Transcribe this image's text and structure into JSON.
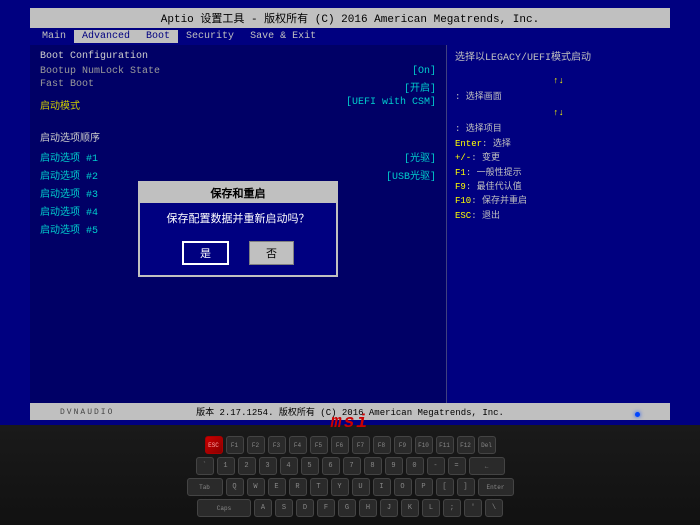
{
  "titleBar": {
    "text": "Aptio 设置工具 - 版权所有 (C) 2016 American Megatrends, Inc."
  },
  "menuBar": {
    "items": [
      {
        "id": "main",
        "label": "Main",
        "active": false
      },
      {
        "id": "advanced",
        "label": "Advanced",
        "active": false
      },
      {
        "id": "boot",
        "label": "Boot",
        "active": true
      },
      {
        "id": "security",
        "label": "Security",
        "active": false
      },
      {
        "id": "save-exit",
        "label": "Save & Exit",
        "active": false
      }
    ]
  },
  "leftPanel": {
    "sectionTitle": "Boot Configuration",
    "rows": [
      {
        "label": "Bootup NumLock State",
        "value": "[On]"
      },
      {
        "label": "Fast Boot",
        "value": "[开启]"
      },
      {
        "label": "启动模式",
        "value": "[UEFI with CSM]"
      }
    ],
    "bootOptionsTitle": "启动选项顺序",
    "bootOptions": [
      {
        "label": "启动选项 #1",
        "value": "[光驱]"
      },
      {
        "label": "启动选项 #2",
        "value": "[USB光驱]"
      },
      {
        "label": "启动选项 #3",
        "value": ""
      },
      {
        "label": "启动选项 #4",
        "value": ""
      },
      {
        "label": "启动选项 #5",
        "value": ""
      }
    ]
  },
  "rightPanel": {
    "helpText": "选择以LEGACY/UEFI模式启动",
    "keyHelp": [
      {
        "key": "↑↓",
        "desc": "选择画面"
      },
      {
        "key": "↑↓",
        "desc": "选择项目"
      },
      {
        "key": "Enter",
        "desc": "选择"
      },
      {
        "key": "+/-",
        "desc": "变更"
      },
      {
        "key": "F1",
        "desc": "一般性提示"
      },
      {
        "key": "F9",
        "desc": "最佳代认值"
      },
      {
        "key": "F10",
        "desc": "保存并重启"
      },
      {
        "key": "ESC",
        "desc": "退出"
      }
    ]
  },
  "dialog": {
    "title": "保存和重启",
    "message": "保存配置数据并重新启动吗？",
    "buttons": [
      {
        "label": "是",
        "selected": true
      },
      {
        "label": "否",
        "selected": false
      }
    ]
  },
  "statusBar": {
    "text": "版本 2.17.1254. 版权所有 (C) 2016 American Megatrends, Inc."
  },
  "msiLogo": "msi",
  "dvnaudio": "DVNAUDIO"
}
